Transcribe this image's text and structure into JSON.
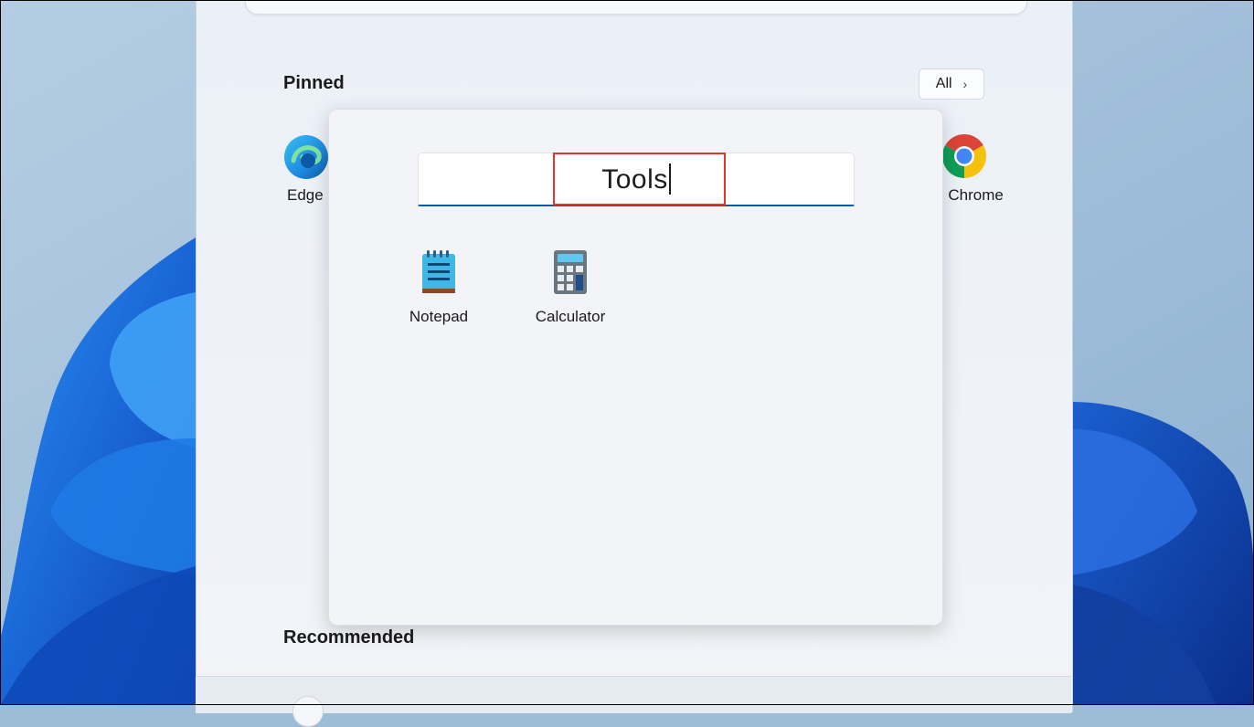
{
  "start_menu": {
    "pinned_heading": "Pinned",
    "all_button_label": "All",
    "all_button_chevron": "›",
    "recommended_heading": "Recommended",
    "pinned_apps": [
      {
        "label": "Edge",
        "icon": "edge-icon"
      },
      {
        "label": "gle Chrome",
        "icon": "chrome-icon"
      }
    ]
  },
  "folder": {
    "name_value": "Tools",
    "apps": [
      {
        "label": "Notepad",
        "icon": "notepad-icon"
      },
      {
        "label": "Calculator",
        "icon": "calculator-icon"
      }
    ]
  },
  "colors": {
    "highlight": "#e5342f",
    "accent_underline": "#0b5cad"
  }
}
